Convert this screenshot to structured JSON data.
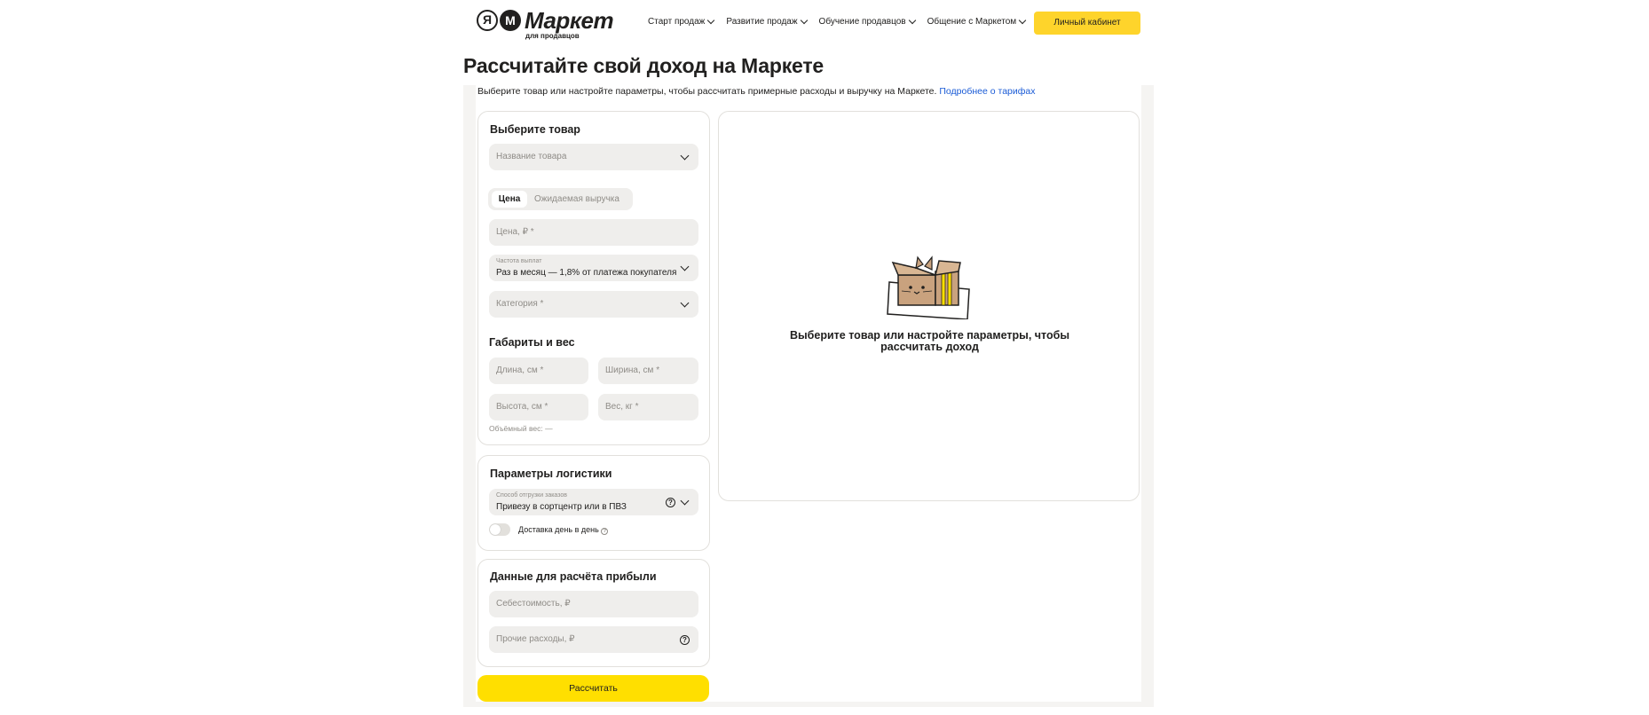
{
  "header": {
    "logo_title": "Маркет",
    "logo_sub": "для продавцов",
    "logo_mark_ya": "Я",
    "logo_mark_m": "M",
    "nav": [
      {
        "label": "Старт продаж"
      },
      {
        "label": "Развитие продаж"
      },
      {
        "label": "Обучение продавцов"
      },
      {
        "label": "Общение с Маркетом"
      }
    ],
    "cabinet_label": "Личный кабинет"
  },
  "page": {
    "title": "Рассчитайте свой доход на Маркете",
    "subtitle": "Выберите товар или настройте параметры, чтобы рассчитать примерные расходы и выручку на Маркете.",
    "tariffs_link": "Подробнее о тарифах"
  },
  "product_card": {
    "title": "Выберите товар",
    "product_placeholder": "Название товара",
    "tabs": {
      "active": "Цена",
      "inactive": "Ожидаемая выручка"
    },
    "price_placeholder": "Цена, ₽ *",
    "payout_label": "Частота выплат",
    "payout_value": "Раз в месяц — 1,8% от платежа покупателя",
    "category_placeholder": "Категория *",
    "dims_title": "Габариты и вес",
    "length_placeholder": "Длина, см *",
    "width_placeholder": "Ширина, см *",
    "height_placeholder": "Высота, см *",
    "weight_placeholder": "Вес, кг *",
    "volume_weight": "Объёмный вес: —"
  },
  "logistics_card": {
    "title": "Параметры логистики",
    "shipping_label": "Способ отгрузки заказов",
    "shipping_value": "Привезу в сортцентр или в ПВЗ",
    "same_day_label": "Доставка день в день",
    "same_day_enabled": false
  },
  "profit_card": {
    "title": "Данные для расчёта прибыли",
    "cost_placeholder": "Себестоимость, ₽",
    "other_placeholder": "Прочие расходы, ₽"
  },
  "calc_button": "Рассчитать",
  "result": {
    "line1": "Выберите товар или настройте параметры, чтобы",
    "line2": "рассчитать доход"
  },
  "colors": {
    "accent_yellow": "#ffdf00",
    "cabinet_yellow": "#fed42b",
    "link_blue": "#1a5bd6"
  }
}
